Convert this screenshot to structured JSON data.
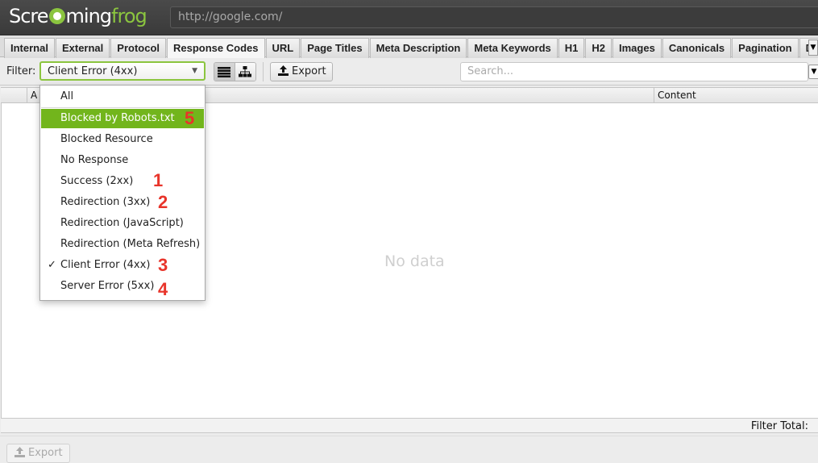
{
  "app": {
    "logo_text_white": "Scre",
    "logo_text_white2": "ming",
    "logo_text_green": "frog",
    "url": "http://google.com/"
  },
  "tabs": [
    {
      "label": "Internal",
      "active": false
    },
    {
      "label": "External",
      "active": false
    },
    {
      "label": "Protocol",
      "active": false
    },
    {
      "label": "Response Codes",
      "active": true
    },
    {
      "label": "URL",
      "active": false
    },
    {
      "label": "Page Titles",
      "active": false
    },
    {
      "label": "Meta Description",
      "active": false
    },
    {
      "label": "Meta Keywords",
      "active": false
    },
    {
      "label": "H1",
      "active": false
    },
    {
      "label": "H2",
      "active": false
    },
    {
      "label": "Images",
      "active": false
    },
    {
      "label": "Canonicals",
      "active": false
    },
    {
      "label": "Pagination",
      "active": false
    },
    {
      "label": "Direct",
      "active": false
    }
  ],
  "filterbar": {
    "label": "Filter:",
    "selected": "Client Error (4xx)",
    "export_label": "Export",
    "search_placeholder": "Search..."
  },
  "table": {
    "columns": [
      "A",
      "Content"
    ],
    "empty_text": "No data"
  },
  "status": {
    "filter_total_label": "Filter Total:"
  },
  "bottom": {
    "export_label": "Export"
  },
  "dropdown": {
    "items": [
      {
        "label": "All",
        "checked": false,
        "highlighted": false,
        "annotation": ""
      },
      {
        "label": "Blocked by Robots.txt",
        "checked": false,
        "highlighted": true,
        "annotation": "5"
      },
      {
        "label": "Blocked Resource",
        "checked": false,
        "highlighted": false,
        "annotation": ""
      },
      {
        "label": "No Response",
        "checked": false,
        "highlighted": false,
        "annotation": ""
      },
      {
        "label": "Success (2xx)",
        "checked": false,
        "highlighted": false,
        "annotation": "1"
      },
      {
        "label": "Redirection (3xx)",
        "checked": false,
        "highlighted": false,
        "annotation": "2"
      },
      {
        "label": "Redirection (JavaScript)",
        "checked": false,
        "highlighted": false,
        "annotation": ""
      },
      {
        "label": "Redirection (Meta Refresh)",
        "checked": false,
        "highlighted": false,
        "annotation": ""
      },
      {
        "label": "Client Error (4xx)",
        "checked": true,
        "highlighted": false,
        "annotation": "3"
      },
      {
        "label": "Server Error (5xx)",
        "checked": false,
        "highlighted": false,
        "annotation": "4"
      }
    ],
    "check_glyph": "✓"
  },
  "colors": {
    "accent_green": "#72b51c",
    "annotation_red": "#e8342a"
  }
}
